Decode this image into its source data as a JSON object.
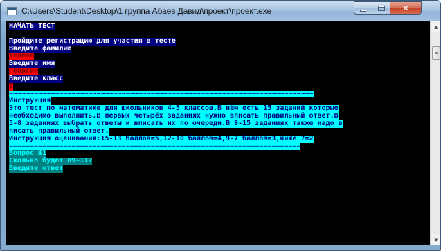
{
  "window": {
    "title": "C:\\Users\\Student\\Desktop\\1 группа Абаев Давид\\проект\\проект.exe",
    "close_glyph": "✕"
  },
  "console": {
    "start_test": "НАЧАТЬ ТЕСТ",
    "register_prompt": "Пройдите регистрацию для участия в тесте",
    "surname_prompt": "Введите фамилию",
    "surname_value": "Тедеев",
    "name_prompt": "Введите имя",
    "name_value": "Георгий",
    "class_prompt": "Введите класс",
    "class_value": "5",
    "divider_tilde": "~~~~~~~~~~~~~~~~~~~~~~~~~~~~~~~~~~~~~~~~~~~~~~~~~~~~~~~~~~~~~~~~~~~~~~~~~",
    "instr_title": "Инструкция",
    "instr_line1": "Это тест по математике для школьников 4-5 классов.В нём есть 15 заданий которые",
    "instr_line2": "необходимо выполнить.В первых четырёх заданиях нужно вписать правильный ответ.В",
    "instr_line3": "5-8 заданиях выбрать ответы и вписать их по очереди.В 9-15 заданиях также надо в",
    "instr_line4": "писать правильный ответ.",
    "grading": "Инструкция оценивания:15-13 баллов=5,12-10 баллов=4,9-7 баллов=3,ниже 7=2",
    "divider_eq": "===================================================================================",
    "question_label": "Вопрос №1",
    "question_text": "Сколько будет 89+11?",
    "answer_prompt": "Введите ответ"
  },
  "scrollbar": {
    "up_glyph": "▲",
    "down_glyph": "▼"
  }
}
